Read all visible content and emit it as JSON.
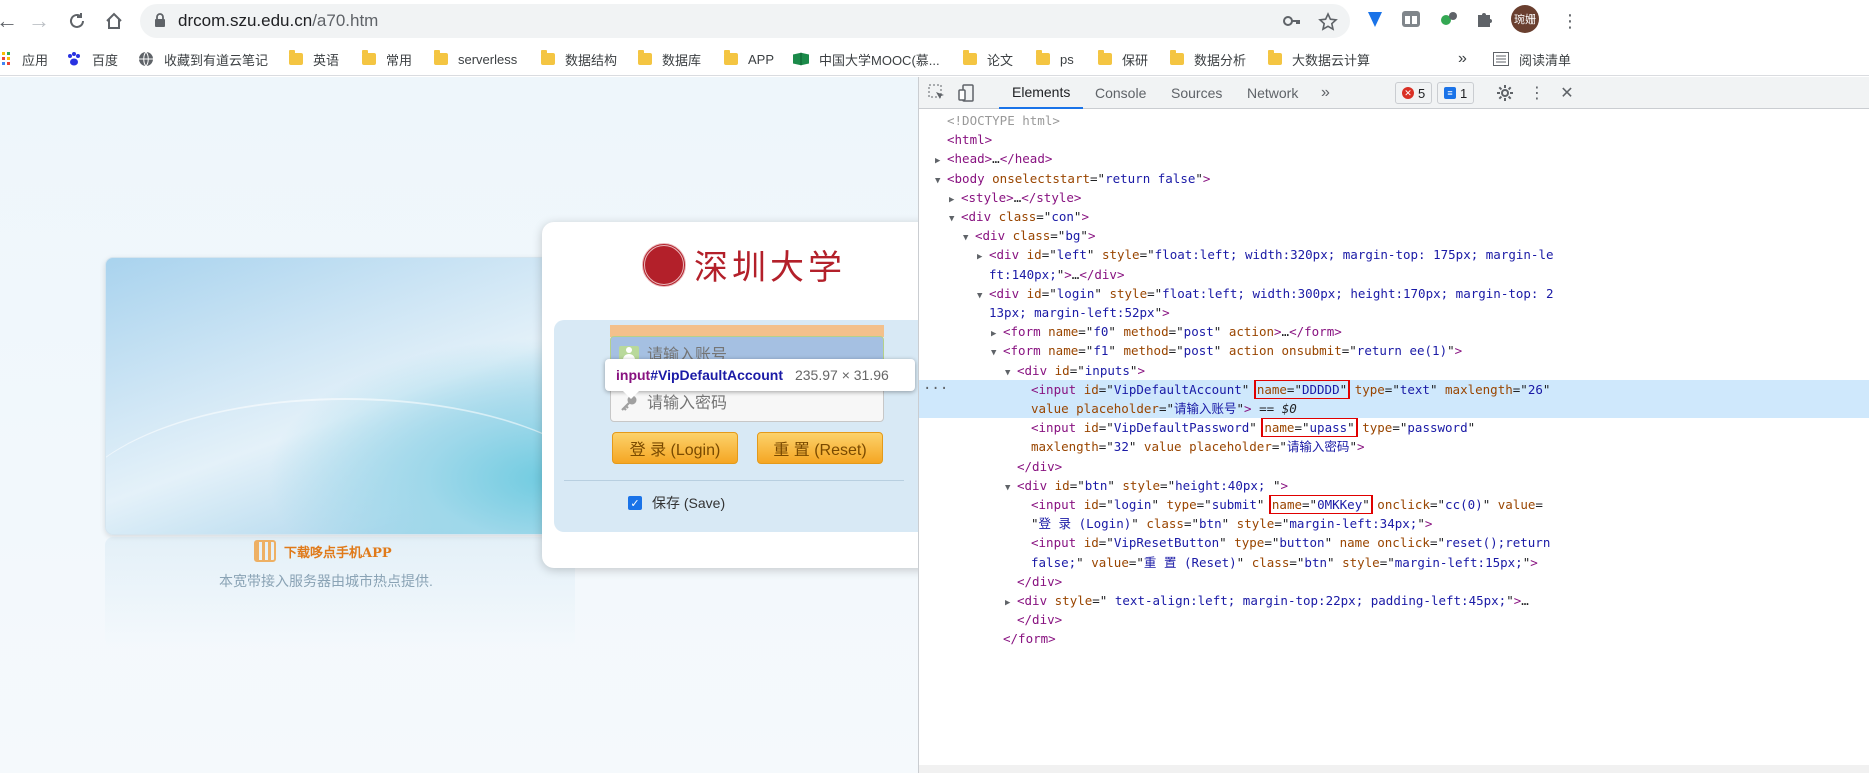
{
  "browser": {
    "url_host": "drcom.szu.edu.cn",
    "url_path": "/a70.htm",
    "avatar_text": "琬姗"
  },
  "bookmarks": [
    {
      "label": "应用",
      "icon": "apps-grid-icon"
    },
    {
      "label": "百度",
      "icon": "baidu-paw-icon"
    },
    {
      "label": "收藏到有道云笔记",
      "icon": "globe-icon"
    },
    {
      "label": "英语",
      "icon": "folder-icon"
    },
    {
      "label": "常用",
      "icon": "folder-icon"
    },
    {
      "label": "serverless",
      "icon": "folder-icon"
    },
    {
      "label": "数据结构",
      "icon": "folder-icon"
    },
    {
      "label": "数据库",
      "icon": "folder-icon"
    },
    {
      "label": "APP",
      "icon": "folder-icon"
    },
    {
      "label": "中国大学MOOC(慕...",
      "icon": "mooc-icon"
    },
    {
      "label": "论文",
      "icon": "folder-icon"
    },
    {
      "label": "ps",
      "icon": "folder-icon"
    },
    {
      "label": "保研",
      "icon": "folder-icon"
    },
    {
      "label": "数据分析",
      "icon": "folder-icon"
    },
    {
      "label": "大数据云计算",
      "icon": "folder-icon"
    }
  ],
  "bookmarks_overflow": "»",
  "reading_list": "阅读清单",
  "page": {
    "university_name": "深圳大学",
    "account_placeholder": "请输入账号",
    "password_placeholder": "请输入密码",
    "login_label": "登 录 (Login)",
    "reset_label": "重 置 (Reset)",
    "save_label": "保存 (Save)",
    "app_download": "下载哆点手机APP",
    "footnote": "本宽带接入服务器由城市热点提供.",
    "tooltip_tag": "input",
    "tooltip_id": "#VipDefaultAccount",
    "tooltip_size": "235.97 × 31.96"
  },
  "devtools": {
    "tabs": [
      "Elements",
      "Console",
      "Sources",
      "Network"
    ],
    "active_tab": "Elements",
    "more_tabs": "»",
    "error_count": "5",
    "message_count": "1",
    "lines": [
      {
        "indent": 0,
        "tri": "",
        "html": "<span class=\"c\">&lt;!DOCTYPE html&gt;</span>"
      },
      {
        "indent": 0,
        "tri": "",
        "html": "<span class=\"t\">&lt;html&gt;</span>"
      },
      {
        "indent": 0,
        "tri": "▶",
        "html": "<span class=\"t\">&lt;head&gt;</span>…<span class=\"t\">&lt;/head&gt;</span>"
      },
      {
        "indent": 0,
        "tri": "▼",
        "html": "<span class=\"t\">&lt;body </span><span class=\"a\">onselectstart</span>=\"<span class=\"v\">return false</span>\"<span class=\"t\">&gt;</span>"
      },
      {
        "indent": 1,
        "tri": "▶",
        "html": "<span class=\"t\">&lt;style&gt;</span>…<span class=\"t\">&lt;/style&gt;</span>"
      },
      {
        "indent": 1,
        "tri": "▼",
        "html": "<span class=\"t\">&lt;div </span><span class=\"a\">class</span>=\"<span class=\"v\">con</span>\"<span class=\"t\">&gt;</span>"
      },
      {
        "indent": 2,
        "tri": "▼",
        "html": "<span class=\"t\">&lt;div </span><span class=\"a\">class</span>=\"<span class=\"v\">bg</span>\"<span class=\"t\">&gt;</span>"
      },
      {
        "indent": 3,
        "tri": "▶",
        "html": "<span class=\"t\">&lt;div </span><span class=\"a\">id</span>=\"<span class=\"v\">left</span>\" <span class=\"a\">style</span>=\"<span class=\"v\">float:left; width:320px; margin-top: 175px; margin-le</span>"
      },
      {
        "indent": 3,
        "tri": "",
        "html": "<span class=\"v\">ft:140px;</span>\"<span class=\"t\">&gt;</span>…<span class=\"t\">&lt;/div&gt;</span>"
      },
      {
        "indent": 3,
        "tri": "▼",
        "html": "<span class=\"t\">&lt;div </span><span class=\"a\">id</span>=\"<span class=\"v\">login</span>\" <span class=\"a\">style</span>=\"<span class=\"v\">float:left; width:300px; height:170px; margin-top: 2</span>"
      },
      {
        "indent": 3,
        "tri": "",
        "html": "<span class=\"v\">13px; margin-left:52px</span>\"<span class=\"t\">&gt;</span>"
      },
      {
        "indent": 4,
        "tri": "▶",
        "html": "<span class=\"t\">&lt;form </span><span class=\"a\">name</span>=\"<span class=\"v\">f0</span>\" <span class=\"a\">method</span>=\"<span class=\"v\">post</span>\" <span class=\"a\">action</span><span class=\"t\">&gt;</span>…<span class=\"t\">&lt;/form&gt;</span>"
      },
      {
        "indent": 4,
        "tri": "▼",
        "html": "<span class=\"t\">&lt;form </span><span class=\"a\">name</span>=\"<span class=\"v\">f1</span>\" <span class=\"a\">method</span>=\"<span class=\"v\">post</span>\" <span class=\"a\">action onsubmit</span>=\"<span class=\"v\">return ee(1)</span>\"<span class=\"t\">&gt;</span>"
      },
      {
        "indent": 5,
        "tri": "▼",
        "html": "<span class=\"t\">&lt;div </span><span class=\"a\">id</span>=\"<span class=\"v\">inputs</span>\"<span class=\"t\">&gt;</span>"
      },
      {
        "indent": 6,
        "tri": "",
        "sel": true,
        "html": "<span class=\"t\">&lt;input </span><span class=\"a\">id</span>=\"<span class=\"v\">VipDefaultAccount</span>\" <span class=\"red-box\"><span class=\"a\">name</span>=\"<span class=\"v\">DDDDD</span>\"</span> <span class=\"a\">type</span>=\"<span class=\"v\">text</span>\" <span class=\"a\">maxlength</span>=\"<span class=\"v\">26</span>\""
      },
      {
        "indent": 6,
        "tri": "",
        "sel": true,
        "html": "<span class=\"a\">value placeholder</span>=\"<span class=\"v\">请输入账号</span>\"<span class=\"t\">&gt;</span> == <i>$0</i>"
      },
      {
        "indent": 6,
        "tri": "",
        "html": "<span class=\"t\">&lt;input </span><span class=\"a\">id</span>=\"<span class=\"v\">VipDefaultPassword</span>\" <span class=\"red-box\"><span class=\"a\">name</span>=\"<span class=\"v\">upass</span>\"</span> <span class=\"a\">type</span>=\"<span class=\"v\">password</span>\""
      },
      {
        "indent": 6,
        "tri": "",
        "html": "<span class=\"a\">maxlength</span>=\"<span class=\"v\">32</span>\" <span class=\"a\">value placeholder</span>=\"<span class=\"v\">请输入密码</span>\"<span class=\"t\">&gt;</span>"
      },
      {
        "indent": 5,
        "tri": "",
        "html": "<span class=\"t\">&lt;/div&gt;</span>"
      },
      {
        "indent": 5,
        "tri": "▼",
        "html": "<span class=\"t\">&lt;div </span><span class=\"a\">id</span>=\"<span class=\"v\">btn</span>\" <span class=\"a\">style</span>=\"<span class=\"v\">height:40px; </span>\"<span class=\"t\">&gt;</span>"
      },
      {
        "indent": 6,
        "tri": "",
        "html": "<span class=\"t\">&lt;input </span><span class=\"a\">id</span>=\"<span class=\"v\">login</span>\" <span class=\"a\">type</span>=\"<span class=\"v\">submit</span>\" <span class=\"red-box\"><span class=\"a\">name</span>=\"<span class=\"v\">0MKKey</span>\"</span> <span class=\"a\">onclick</span>=\"<span class=\"v\">cc(0)</span>\" <span class=\"a\">value</span>="
      },
      {
        "indent": 6,
        "tri": "",
        "html": "\"<span class=\"v\">登 录 (Login)</span>\" <span class=\"a\">class</span>=\"<span class=\"v\">btn</span>\" <span class=\"a\">style</span>=\"<span class=\"v\">margin-left:34px;</span>\"<span class=\"t\">&gt;</span>"
      },
      {
        "indent": 6,
        "tri": "",
        "html": "<span class=\"t\">&lt;input </span><span class=\"a\">id</span>=\"<span class=\"v\">VipResetButton</span>\" <span class=\"a\">type</span>=\"<span class=\"v\">button</span>\" <span class=\"a\">name onclick</span>=\"<span class=\"v\">reset();return</span>"
      },
      {
        "indent": 6,
        "tri": "",
        "html": "<span class=\"v\">false;</span>\" <span class=\"a\">value</span>=\"<span class=\"v\">重 置 (Reset)</span>\" <span class=\"a\">class</span>=\"<span class=\"v\">btn</span>\" <span class=\"a\">style</span>=\"<span class=\"v\">margin-left:15px;</span>\"<span class=\"t\">&gt;</span>"
      },
      {
        "indent": 5,
        "tri": "",
        "html": "<span class=\"t\">&lt;/div&gt;</span>"
      },
      {
        "indent": 5,
        "tri": "▶",
        "html": "<span class=\"t\">&lt;div </span><span class=\"a\">style</span>=\"<span class=\"v\"> text-align:left; margin-top:22px; padding-left:45px;</span>\"<span class=\"t\">&gt;</span>…"
      },
      {
        "indent": 5,
        "tri": "",
        "html": "<span class=\"t\">&lt;/div&gt;</span>"
      },
      {
        "indent": 4,
        "tri": "",
        "html": "<span class=\"t\">&lt;/form&gt;</span>"
      }
    ]
  }
}
